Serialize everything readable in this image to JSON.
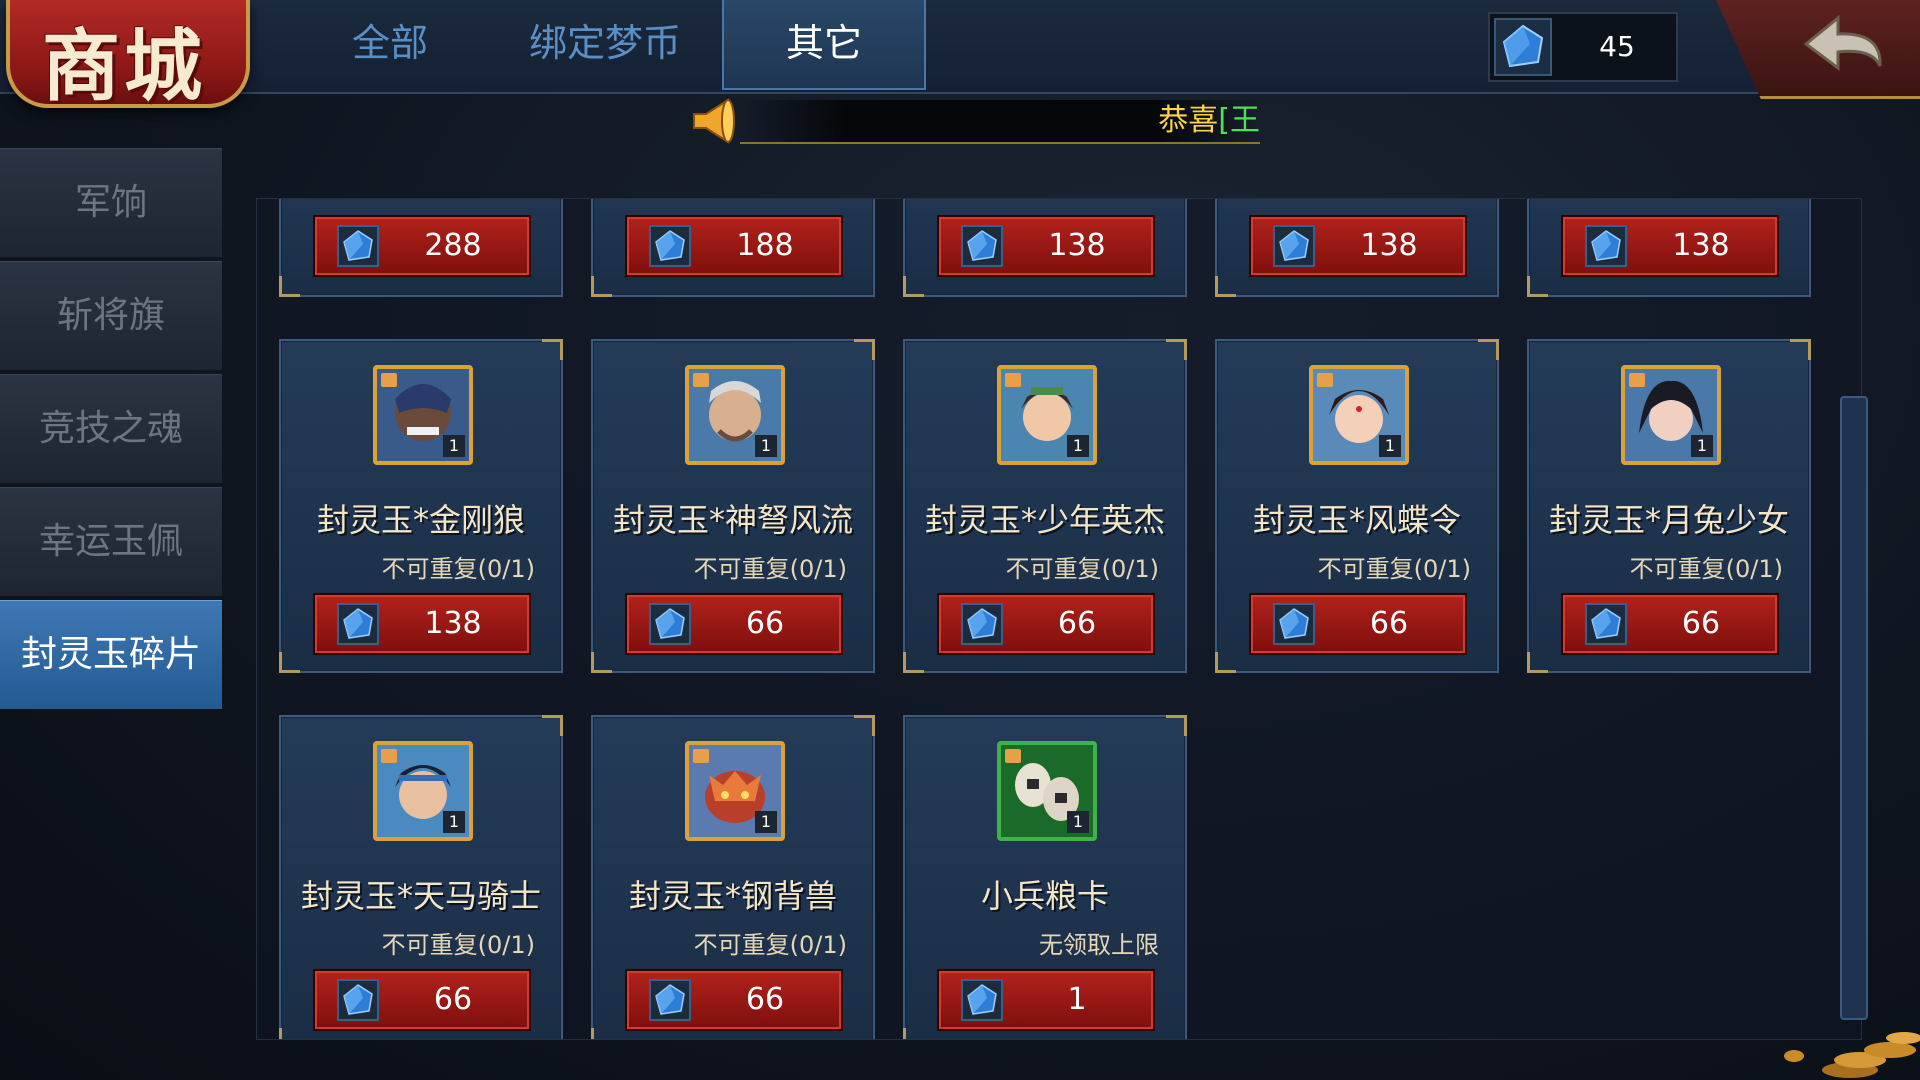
{
  "header": {
    "title": "商城",
    "tabs": [
      {
        "label": "全部"
      },
      {
        "label": "绑定梦币"
      },
      {
        "label": "其它"
      }
    ],
    "currency": {
      "icon": "blue-gem-icon",
      "value": "45"
    }
  },
  "marquee": {
    "text_prefix": "恭喜",
    "text_highlight": "[王"
  },
  "sidebar": {
    "items": [
      {
        "label": "军饷"
      },
      {
        "label": "斩将旗"
      },
      {
        "label": "竞技之魂"
      },
      {
        "label": "幸运玉佩"
      },
      {
        "label": "封灵玉碎片"
      }
    ],
    "active_index": 4
  },
  "shop": {
    "top_row_prices": [
      "288",
      "188",
      "138",
      "138",
      "138"
    ],
    "items": [
      {
        "name": "封灵玉*金刚狼",
        "limit": "不可重复(0/1)",
        "price": "138",
        "qty": "1",
        "portrait": "warrior-dark"
      },
      {
        "name": "封灵玉*神弩风流",
        "limit": "不可重复(0/1)",
        "price": "66",
        "qty": "1",
        "portrait": "archer-elder"
      },
      {
        "name": "封灵玉*少年英杰",
        "limit": "不可重复(0/1)",
        "price": "66",
        "qty": "1",
        "portrait": "youth-hero"
      },
      {
        "name": "封灵玉*风蝶令",
        "limit": "不可重复(0/1)",
        "price": "66",
        "qty": "1",
        "portrait": "lady-red"
      },
      {
        "name": "封灵玉*月兔少女",
        "limit": "不可重复(0/1)",
        "price": "66",
        "qty": "1",
        "portrait": "girl-dark"
      },
      {
        "name": "封灵玉*天马骑士",
        "limit": "不可重复(0/1)",
        "price": "66",
        "qty": "1",
        "portrait": "knight"
      },
      {
        "name": "封灵玉*钢背兽",
        "limit": "不可重复(0/1)",
        "price": "66",
        "qty": "1",
        "portrait": "beast"
      },
      {
        "name": "小兵粮卡",
        "limit": "无领取上限",
        "price": "1",
        "qty": "1",
        "portrait": "rice-bags"
      }
    ]
  },
  "colors": {
    "accent_blue": "#3e78b4",
    "price_red": "#b2221c",
    "gold": "#d9a23a",
    "gem_blue": "#2e7ed8"
  }
}
